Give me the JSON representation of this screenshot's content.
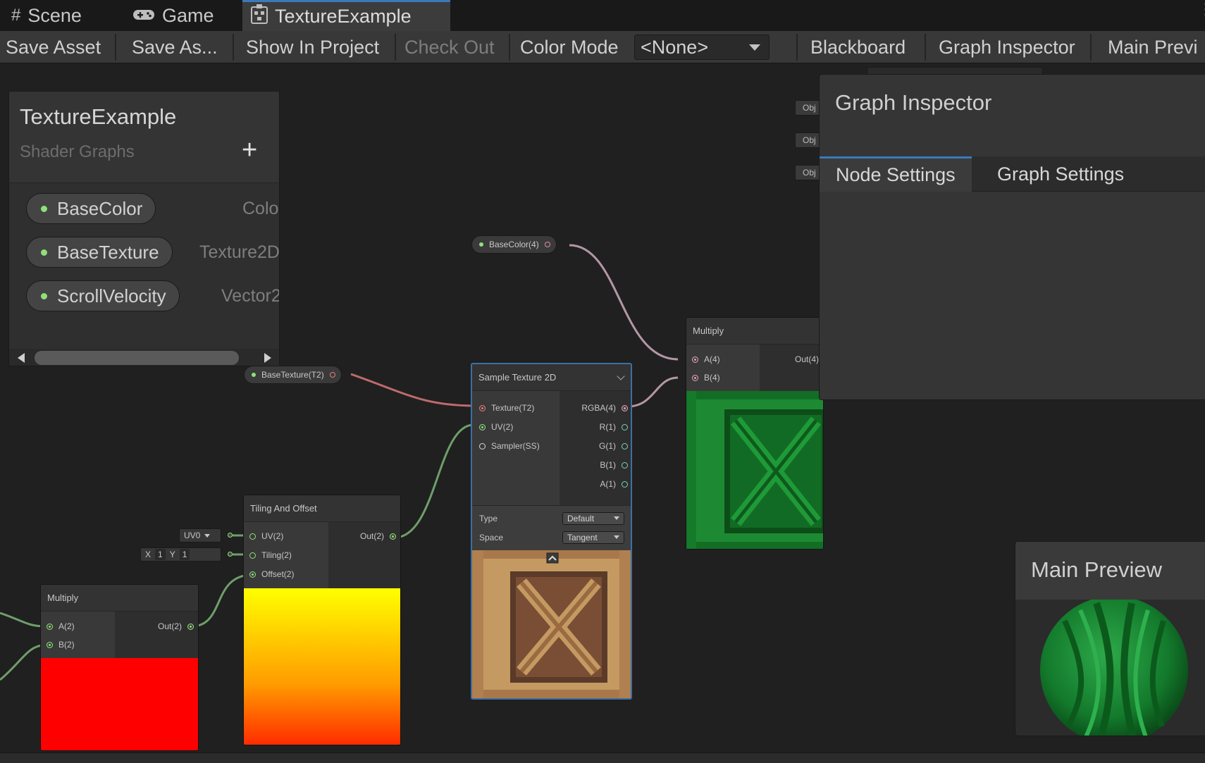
{
  "tabs": [
    {
      "label": "Scene",
      "icon": "hash-icon"
    },
    {
      "label": "Game",
      "icon": "gamepad-icon"
    },
    {
      "label": "TextureExample",
      "icon": "shader-graph-icon"
    }
  ],
  "toolbar": {
    "save_asset": "Save Asset",
    "save_as": "Save As...",
    "show_in_project": "Show In Project",
    "check_out": "Check Out",
    "color_mode_label": "Color Mode",
    "color_mode_value": "<None>",
    "blackboard": "Blackboard",
    "graph_inspector": "Graph Inspector",
    "main_preview": "Main Previ"
  },
  "blackboard": {
    "title": "TextureExample",
    "subtitle": "Shader Graphs",
    "add": "+",
    "properties": [
      {
        "name": "BaseColor",
        "type": "Colo"
      },
      {
        "name": "BaseTexture",
        "type": "Texture2D"
      },
      {
        "name": "ScrollVelocity",
        "type": "Vector2"
      }
    ]
  },
  "pills": {
    "base_color": "BaseColor(4)",
    "base_texture": "BaseTexture(T2)"
  },
  "sample_texture": {
    "title": "Sample Texture 2D",
    "inputs": [
      "Texture(T2)",
      "UV(2)",
      "Sampler(SS)"
    ],
    "outputs": [
      "RGBA(4)",
      "R(1)",
      "G(1)",
      "B(1)",
      "A(1)"
    ],
    "type_label": "Type",
    "type_value": "Default",
    "space_label": "Space",
    "space_value": "Tangent"
  },
  "multiply_top": {
    "title": "Multiply",
    "inputs": [
      "A(4)",
      "B(4)"
    ],
    "output": "Out(4)"
  },
  "tiling": {
    "title": "Tiling And Offset",
    "inputs": [
      "UV(2)",
      "Tiling(2)",
      "Offset(2)"
    ],
    "output": "Out(2)",
    "uv_channel": "UV0",
    "x_label": "X",
    "x_value": "1",
    "y_label": "Y",
    "y_value": "1"
  },
  "multiply_bottom": {
    "title": "Multiply",
    "inputs": [
      "A(2)",
      "B(2)"
    ],
    "output": "Out(2)"
  },
  "inspector": {
    "title": "Graph Inspector",
    "tabs": [
      "Node Settings",
      "Graph Settings"
    ],
    "obj_chips": [
      "Obj",
      "Obj",
      "Obj"
    ]
  },
  "preview": {
    "title": "Main Preview"
  },
  "colors": {
    "accent": "#3a79bb",
    "property_dot": "#8fe07a",
    "crate_green": "#1f8a34",
    "crate_wood": "#c49a62"
  }
}
